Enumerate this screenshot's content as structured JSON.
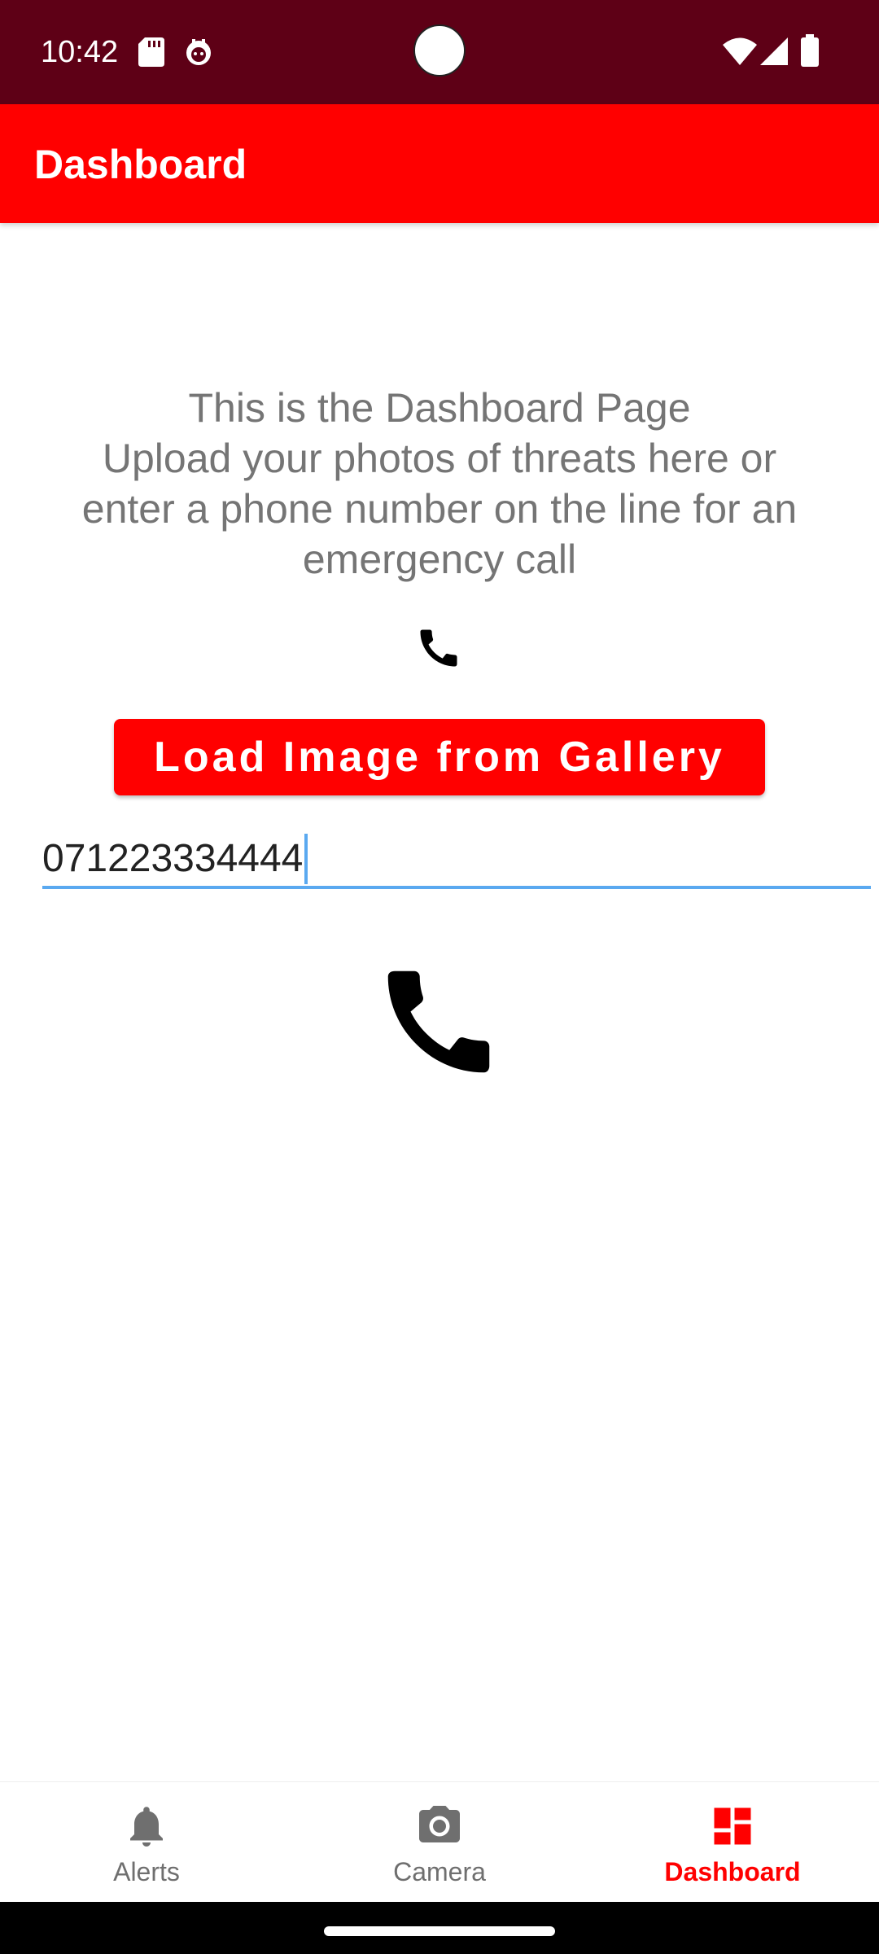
{
  "status_bar": {
    "time": "10:42",
    "icons": [
      "sd-card-icon",
      "notification-app-icon",
      "wifi-icon",
      "cell-signal-icon",
      "battery-icon"
    ]
  },
  "app_bar": {
    "title": "Dashboard"
  },
  "content": {
    "intro_lines": [
      "This is the Dashboard Page",
      "Upload your photos of threats here or",
      "enter a phone number on the line for an",
      "emergency call"
    ],
    "load_button_label": "Load Image from Gallery",
    "phone_input_value": "071223334444"
  },
  "bottom_nav": {
    "items": [
      {
        "label": "Alerts",
        "icon": "bell-icon",
        "active": false
      },
      {
        "label": "Camera",
        "icon": "camera-icon",
        "active": false
      },
      {
        "label": "Dashboard",
        "icon": "dashboard-icon",
        "active": true
      }
    ]
  },
  "colors": {
    "status_bar": "#5e0016",
    "app_bar": "#ff0000",
    "accent": "#ff0000",
    "input_underline": "#5aa9f0",
    "body_text": "#757575",
    "nav_inactive": "#6f6f6f"
  }
}
